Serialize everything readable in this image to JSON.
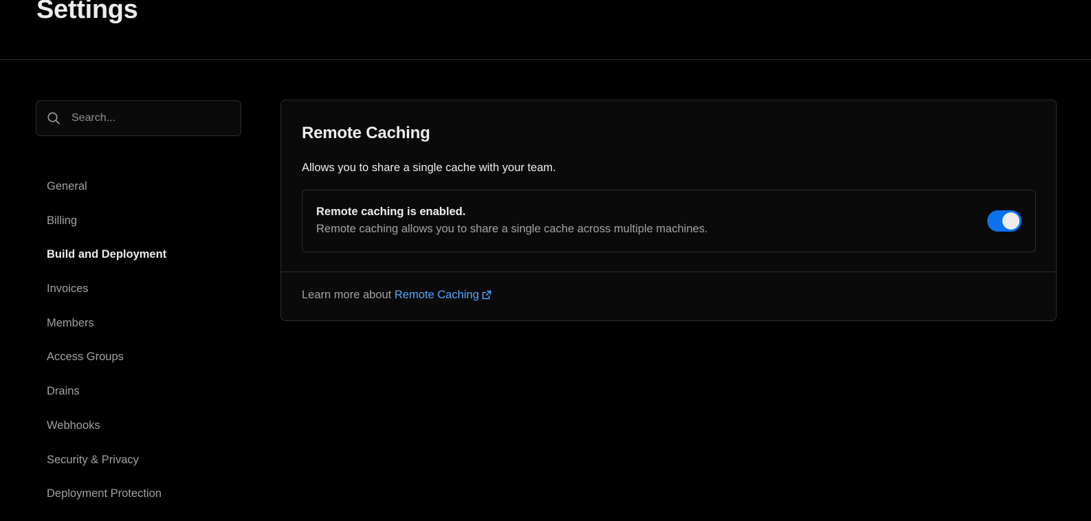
{
  "header": {
    "title": "Settings"
  },
  "sidebar": {
    "search": {
      "placeholder": "Search..."
    },
    "items": [
      {
        "label": "General",
        "active": false
      },
      {
        "label": "Billing",
        "active": false
      },
      {
        "label": "Build and Deployment",
        "active": true
      },
      {
        "label": "Invoices",
        "active": false
      },
      {
        "label": "Members",
        "active": false
      },
      {
        "label": "Access Groups",
        "active": false
      },
      {
        "label": "Drains",
        "active": false
      },
      {
        "label": "Webhooks",
        "active": false
      },
      {
        "label": "Security & Privacy",
        "active": false
      },
      {
        "label": "Deployment Protection",
        "active": false
      }
    ]
  },
  "card": {
    "title": "Remote Caching",
    "description": "Allows you to share a single cache with your team.",
    "status": {
      "title": "Remote caching is enabled.",
      "subtitle": "Remote caching allows you to share a single cache across multiple machines.",
      "toggle_enabled": true
    },
    "footer": {
      "prefix": "Learn more about",
      "link_label": "Remote Caching"
    }
  },
  "colors": {
    "background": "#000000",
    "surface": "#0a0a0a",
    "border": "#2e2e2e",
    "toggle_on": "#0a72ef",
    "link": "#52a8ff"
  },
  "icons": {
    "search": "search-icon",
    "external_link": "external-link-icon"
  }
}
